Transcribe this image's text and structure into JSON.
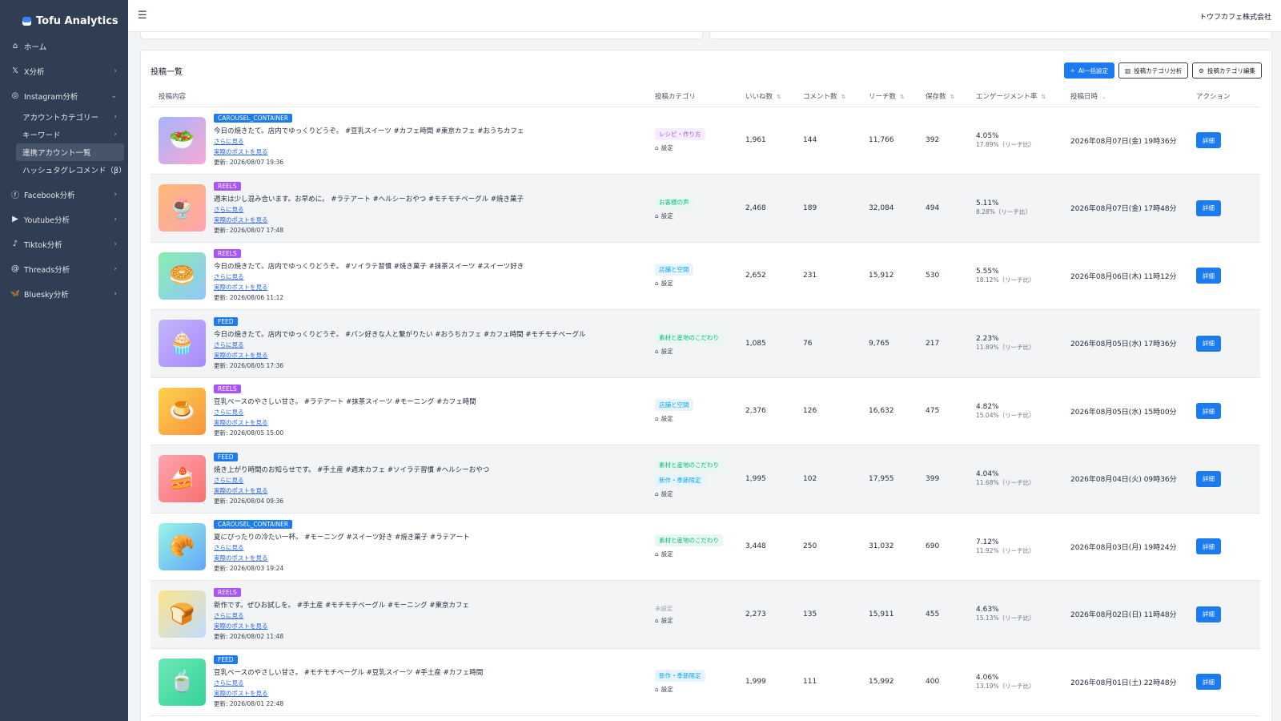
{
  "app": {
    "brand": "Tofu Analytics",
    "company": "トウフカフェ株式会社"
  },
  "sidebar": {
    "items": [
      {
        "label": "ホーム",
        "icon": "home-icon",
        "glyph": "⌂",
        "chevron": ""
      },
      {
        "label": "X分析",
        "icon": "x-logo-icon",
        "glyph": "𝕏",
        "chevron": "›"
      },
      {
        "label": "Instagram分析",
        "icon": "instagram-icon",
        "glyph": "◎",
        "chevron": "⌄"
      }
    ],
    "instagram_sub": [
      {
        "label": "アカウントカテゴリー",
        "chevron": "›"
      },
      {
        "label": "キーワード",
        "chevron": "›"
      },
      {
        "label": "連携アカウント一覧",
        "chevron": ""
      },
      {
        "label": "ハッシュタグレコメンド（β）",
        "chevron": ""
      }
    ],
    "items_after": [
      {
        "label": "Facebook分析",
        "icon": "facebook-icon",
        "glyph": "ⓕ",
        "chevron": "›"
      },
      {
        "label": "Youtube分析",
        "icon": "youtube-icon",
        "glyph": "▶",
        "chevron": "›"
      },
      {
        "label": "Tiktok分析",
        "icon": "tiktok-icon",
        "glyph": "♪",
        "chevron": "›"
      },
      {
        "label": "Threads分析",
        "icon": "threads-icon",
        "glyph": "@",
        "chevron": "›"
      },
      {
        "label": "Bluesky分析",
        "icon": "bluesky-icon",
        "glyph": "🦋",
        "chevron": "›"
      }
    ]
  },
  "posts_card": {
    "title": "投稿一覧",
    "buttons": {
      "ai": "AI一括設定",
      "analysis": "投稿カテゴリ分析",
      "edit": "投稿カテゴリ編集"
    },
    "columns": [
      "投稿内容",
      "投稿カテゴリ",
      "いいね数",
      "コメント数",
      "リーチ数",
      "保存数",
      "エンゲージメント率",
      "投稿日時",
      "アクション"
    ],
    "more_label": "さらに見る",
    "view_post_label": "実際のポストを見る",
    "setting_label": "設定",
    "detail_label": "詳細",
    "rows": [
      {
        "type": "CAROUSEL_CONTAINER",
        "emoji": "🥗",
        "thumb_bg": "linear-gradient(135deg,#a5b4fc,#f9a8d4)",
        "caption": "今日の焼きたて。店内でゆっくりどうぞ。 #豆乳スイーツ #カフェ時間 #東京カフェ #おうちカフェ",
        "updated": "更新: 2026/08/07 19:36",
        "categories": [
          {
            "label": "レシピ・作り方",
            "color": "#a855f7",
            "bg": "#f5ecfe"
          }
        ],
        "likes": "1,961",
        "comments": "144",
        "reach": "11,766",
        "saves": "392",
        "eng": "4.05%",
        "eng_sub": "17.89%（リーチ比）",
        "date": "2026年08月07日(金) 19時36分"
      },
      {
        "type": "REELS",
        "emoji": "🍨",
        "thumb_bg": "linear-gradient(135deg,#fdba74,#fda4af)",
        "caption": "週末は少し混み合います。お早めに。 #ラテアート #ヘルシーおやつ #モチモチベーグル #焼き菓子",
        "updated": "更新: 2026/08/07 17:48",
        "categories": [
          {
            "label": "お客様の声",
            "color": "#10b981",
            "bg": "#e7f8f0"
          }
        ],
        "likes": "2,468",
        "comments": "189",
        "reach": "32,084",
        "saves": "494",
        "eng": "5.11%",
        "eng_sub": "8.28%（リーチ比）",
        "date": "2026年08月07日(金) 17時48分"
      },
      {
        "type": "REELS",
        "emoji": "🥯",
        "thumb_bg": "linear-gradient(135deg,#86efac,#93c5fd)",
        "caption": "今日の焼きたて。店内でゆっくりどうぞ。 #ソイラテ習慣 #焼き菓子 #抹茶スイーツ #スイーツ好き",
        "updated": "更新: 2026/08/06 11:12",
        "categories": [
          {
            "label": "店舗と空間",
            "color": "#0ea5e9",
            "bg": "#e6f5fd"
          }
        ],
        "likes": "2,652",
        "comments": "231",
        "reach": "15,912",
        "saves": "530",
        "eng": "5.55%",
        "eng_sub": "18.12%（リーチ比）",
        "date": "2026年08月06日(木) 11時12分"
      },
      {
        "type": "FEED",
        "emoji": "🧁",
        "thumb_bg": "linear-gradient(135deg,#c4b5fd,#a78bfa)",
        "caption": "今日の焼きたて。店内でゆっくりどうぞ。 #パン好きな人と繋がりたい #おうちカフェ #カフェ時間 #モチモチベーグル",
        "updated": "更新: 2026/08/05 17:36",
        "categories": [
          {
            "label": "素材と産地のこだわり",
            "color": "#10b981",
            "bg": "#e7f8f0"
          }
        ],
        "likes": "1,085",
        "comments": "76",
        "reach": "9,765",
        "saves": "217",
        "eng": "2.23%",
        "eng_sub": "11.89%（リーチ比）",
        "date": "2026年08月05日(水) 17時36分"
      },
      {
        "type": "REELS",
        "emoji": "🍮",
        "thumb_bg": "linear-gradient(135deg,#fcd34d,#fb923c)",
        "caption": "豆乳ベースのやさしい甘さ。 #ラテアート #抹茶スイーツ #モーニング #カフェ時間",
        "updated": "更新: 2026/08/05 15:00",
        "categories": [
          {
            "label": "店舗と空間",
            "color": "#0ea5e9",
            "bg": "#e6f5fd"
          }
        ],
        "likes": "2,376",
        "comments": "126",
        "reach": "16,632",
        "saves": "475",
        "eng": "4.82%",
        "eng_sub": "15.04%（リーチ比）",
        "date": "2026年08月05日(水) 15時00分"
      },
      {
        "type": "FEED",
        "emoji": "🍰",
        "thumb_bg": "linear-gradient(135deg,#fda4af,#f87171)",
        "caption": "焼き上がり時間のお知らせです。 #手土産 #週末カフェ #ソイラテ習慣 #ヘルシーおやつ",
        "updated": "更新: 2026/08/04 09:36",
        "categories": [
          {
            "label": "素材と産地のこだわり",
            "color": "#10b981",
            "bg": "#e7f8f0"
          },
          {
            "label": "新作・季節限定",
            "color": "#0ea5e9",
            "bg": "#e6f5fd"
          }
        ],
        "likes": "1,995",
        "comments": "102",
        "reach": "17,955",
        "saves": "399",
        "eng": "4.04%",
        "eng_sub": "11.68%（リーチ比）",
        "date": "2026年08月04日(火) 09時36分"
      },
      {
        "type": "CAROUSEL_CONTAINER",
        "emoji": "🥐",
        "thumb_bg": "linear-gradient(135deg,#99f6e4,#60a5fa)",
        "caption": "夏にぴったりの冷たい一杯。 #モーニング #スイーツ好き #焼き菓子 #ラテアート",
        "updated": "更新: 2026/08/03 19:24",
        "categories": [
          {
            "label": "素材と産地のこだわり",
            "color": "#10b981",
            "bg": "#e7f8f0"
          }
        ],
        "likes": "3,448",
        "comments": "250",
        "reach": "31,032",
        "saves": "690",
        "eng": "7.12%",
        "eng_sub": "11.92%（リーチ比）",
        "date": "2026年08月03日(月) 19時24分"
      },
      {
        "type": "REELS",
        "emoji": "🍞",
        "thumb_bg": "linear-gradient(135deg,#fde68a,#bfdbfe)",
        "caption": "新作です。ぜひお試しを。 #手土産 #モチモチベーグル #モーニング #東京カフェ",
        "updated": "更新: 2026/08/02 11:48",
        "categories": [],
        "unset_label": "未設定",
        "likes": "2,273",
        "comments": "135",
        "reach": "15,911",
        "saves": "455",
        "eng": "4.63%",
        "eng_sub": "15.13%（リーチ比）",
        "date": "2026年08月02日(日) 11時48分"
      },
      {
        "type": "FEED",
        "emoji": "🍵",
        "thumb_bg": "linear-gradient(135deg,#6ee7b7,#34d399)",
        "caption": "豆乳ベースのやさしい甘さ。 #モチモチベーグル #豆乳スイーツ #手土産 #カフェ時間",
        "updated": "更新: 2026/08/01 22:48",
        "categories": [
          {
            "label": "新作・季節限定",
            "color": "#0ea5e9",
            "bg": "#e6f5fd"
          }
        ],
        "likes": "1,999",
        "comments": "111",
        "reach": "15,992",
        "saves": "400",
        "eng": "4.06%",
        "eng_sub": "13.19%（リーチ比）",
        "date": "2026年08月01日(土) 22時48分"
      }
    ]
  },
  "colors": {
    "sidebar": "#2f3e52",
    "primary": "#1d7bf0",
    "badge_carousel": "#1d7bf0",
    "badge_reels": "#a855f7",
    "badge_feed": "#1d7bf0"
  }
}
